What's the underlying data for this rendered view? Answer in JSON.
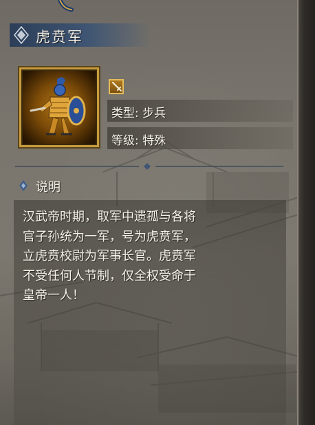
{
  "unit": {
    "name": "虎贲军",
    "portrait": "armored-shield-soldier",
    "type_icon": "sword-icon",
    "type_line": "类型: 步兵",
    "level_line": "等级: 特殊"
  },
  "description": {
    "title": "说明",
    "text": "汉武帝时期，取军中遗孤与各将\n官子孙统为一军，号为虎贲军，\n立虎贲校尉为军事长官。虎贲军\n不受任何人节制，仅全权受命于\n皇帝一人！"
  },
  "colors": {
    "panel_bg": "#7a766e",
    "banner": "#3f5573",
    "gold_frame": "#c79b3e",
    "text": "#f4f0e6"
  }
}
